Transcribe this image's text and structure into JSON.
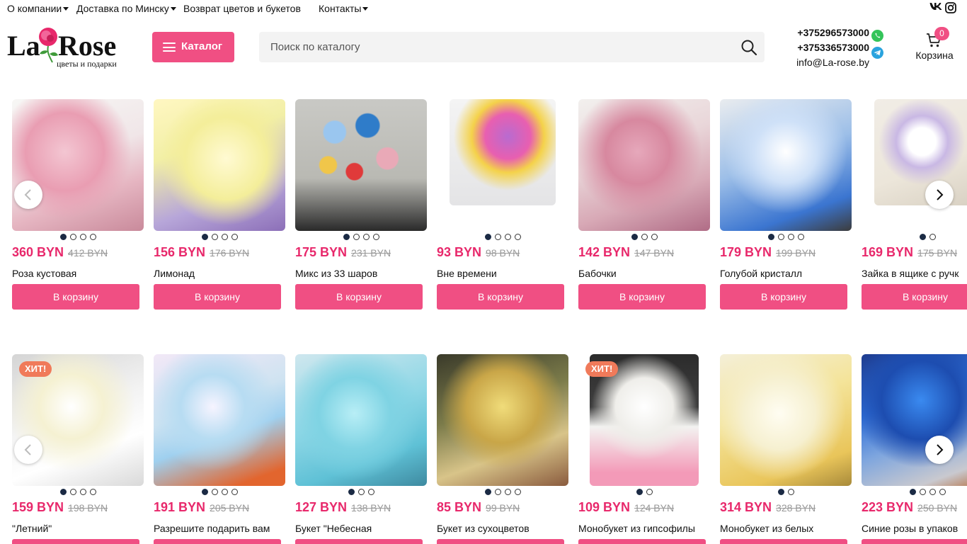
{
  "topnav": [
    {
      "label": "О компании",
      "dropdown": true
    },
    {
      "label": "Доставка по Минску",
      "dropdown": true
    },
    {
      "label": "Возврат цветов и букетов",
      "dropdown": false
    },
    {
      "label": "Контакты",
      "dropdown": true
    }
  ],
  "social": {
    "vk": "vk-icon",
    "instagram": "instagram-icon"
  },
  "logo": {
    "brand": "LaRose",
    "tagline": "цветы и подарки"
  },
  "catalog_button": "Каталог",
  "search": {
    "placeholder": "Поиск по каталогу",
    "value": ""
  },
  "contacts": {
    "phone1": "+375296573000",
    "phone2": "+375336573000",
    "email": "info@La-rose.by"
  },
  "cart": {
    "label": "Корзина",
    "count": "0"
  },
  "buy_label": "В корзину",
  "hit_label": "ХИТ!",
  "colors": {
    "accent": "#f04f83",
    "price": "#e8286b",
    "hit": "#f07a5a"
  },
  "rows": [
    [
      {
        "price": "360 BYN",
        "old": "412 BYN",
        "name": "Роза кустовая",
        "dots": 4,
        "hit": false
      },
      {
        "price": "156 BYN",
        "old": "176 BYN",
        "name": "Лимонад",
        "dots": 4,
        "hit": false
      },
      {
        "price": "175 BYN",
        "old": "231 BYN",
        "name": "Микс из 33 шаров",
        "dots": 4,
        "hit": false
      },
      {
        "price": "93 BYN",
        "old": "98 BYN",
        "name": "Вне времени",
        "dots": 4,
        "hit": false
      },
      {
        "price": "142 BYN",
        "old": "147 BYN",
        "name": "Бабочки",
        "dots": 3,
        "hit": false
      },
      {
        "price": "179 BYN",
        "old": "199 BYN",
        "name": "Голубой кристалл",
        "dots": 4,
        "hit": false
      },
      {
        "price": "169 BYN",
        "old": "175 BYN",
        "name": "Зайка в ящике с ручк",
        "dots": 2,
        "hit": false
      }
    ],
    [
      {
        "price": "159 BYN",
        "old": "198 BYN",
        "name": "\"Летний\"",
        "dots": 4,
        "hit": true
      },
      {
        "price": "191 BYN",
        "old": "205 BYN",
        "name": "Разрешите подарить вам",
        "dots": 4,
        "hit": false
      },
      {
        "price": "127 BYN",
        "old": "138 BYN",
        "name": "Букет \"Небесная",
        "dots": 3,
        "hit": false
      },
      {
        "price": "85 BYN",
        "old": "99 BYN",
        "name": "Букет из сухоцветов",
        "dots": 4,
        "hit": false
      },
      {
        "price": "109 BYN",
        "old": "124 BYN",
        "name": "Монобукет из гипсофилы",
        "dots": 2,
        "hit": true
      },
      {
        "price": "314 BYN",
        "old": "328 BYN",
        "name": "Монобукет из белых",
        "dots": 2,
        "hit": false
      },
      {
        "price": "223 BYN",
        "old": "250 BYN",
        "name": "Синие розы в упаков",
        "dots": 4,
        "hit": false
      }
    ]
  ]
}
